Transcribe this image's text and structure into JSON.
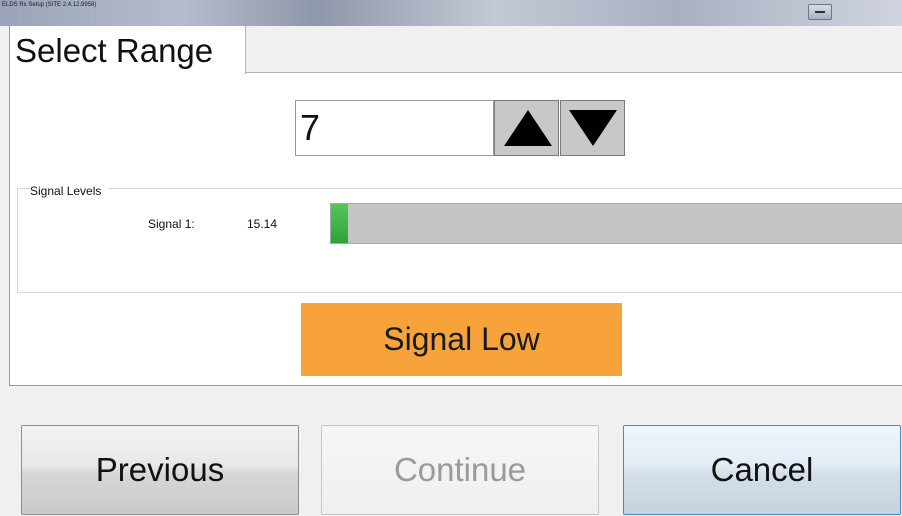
{
  "window": {
    "title": "ELDS Rx Setup (SITE 2.4.12.9958)"
  },
  "tab": {
    "label": "Select Range"
  },
  "range": {
    "value": "7"
  },
  "signal_levels": {
    "legend": "Signal Levels",
    "signals": [
      {
        "label": "Signal 1:",
        "value": "15.14",
        "level_fraction": 0.03
      }
    ],
    "meter_color": "#3bb143"
  },
  "status": {
    "text": "Signal Low",
    "color": "#f7a23b"
  },
  "buttons": {
    "previous": "Previous",
    "continue": "Continue",
    "cancel": "Cancel"
  }
}
